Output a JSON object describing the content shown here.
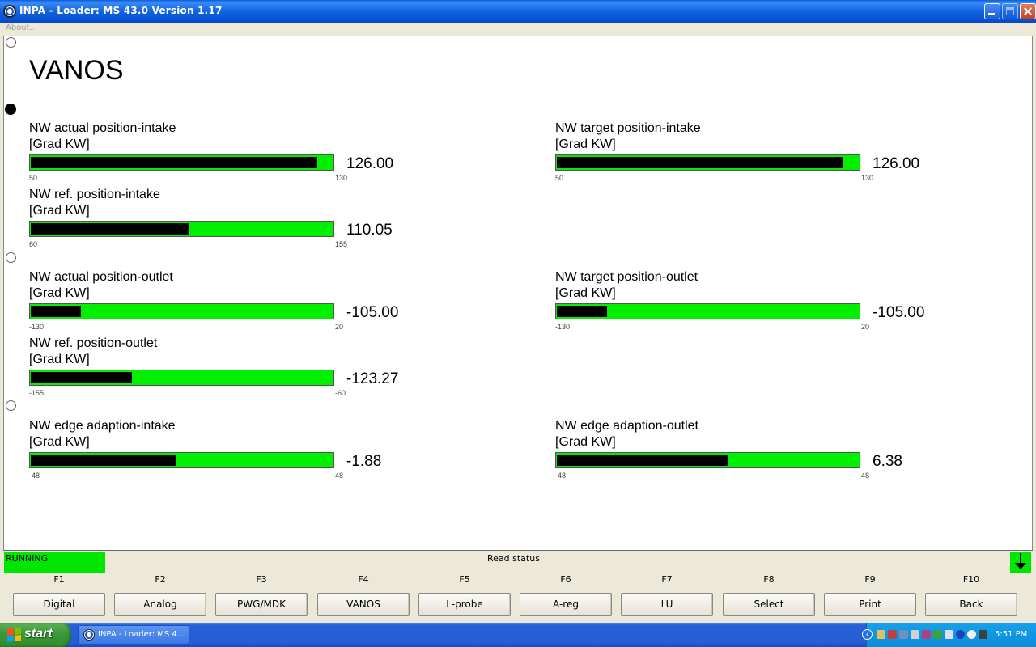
{
  "window": {
    "title": "INPA - Loader:  MS 43.0 Version 1.17"
  },
  "menu": {
    "about": "About..."
  },
  "page": {
    "title": "VANOS"
  },
  "gauges": [
    {
      "label": "NW actual position-intake",
      "unit": "[Grad KW]",
      "value": "126.00",
      "min": "50",
      "max": "130",
      "level": 0.95
    },
    {
      "label": "NW target position-intake",
      "unit": "[Grad KW]",
      "value": "126.00",
      "min": "50",
      "max": "130",
      "level": 0.95
    },
    {
      "label": "NW ref. position-intake",
      "unit": "[Grad KW]",
      "value": "110.05",
      "min": "60",
      "max": "155",
      "level": 0.5268
    },
    {
      "label": "NW actual position-outlet",
      "unit": "[Grad KW]",
      "value": "-105.00",
      "min": "-130",
      "max": "20",
      "level": 0.1667
    },
    {
      "label": "NW target position-outlet",
      "unit": "[Grad KW]",
      "value": "-105.00",
      "min": "-130",
      "max": "20",
      "level": 0.1667
    },
    {
      "label": "NW ref. position-outlet",
      "unit": "[Grad KW]",
      "value": "-123.27",
      "min": "-155",
      "max": "-60",
      "level": 0.334
    },
    {
      "label": "NW edge adaption-intake",
      "unit": "[Grad KW]",
      "value": "-1.88",
      "min": "-48",
      "max": "48",
      "level": 0.4804
    },
    {
      "label": "NW edge adaption-outlet",
      "unit": "[Grad KW]",
      "value": "6.38",
      "min": "-48",
      "max": "48",
      "level": 0.5665
    }
  ],
  "status": {
    "running": "RUNNING",
    "message": "Read status"
  },
  "fkeys": [
    {
      "key": "F1",
      "label": "Digital"
    },
    {
      "key": "F2",
      "label": "Analog"
    },
    {
      "key": "F3",
      "label": "PWG/MDK"
    },
    {
      "key": "F4",
      "label": "VANOS"
    },
    {
      "key": "F5",
      "label": "L-probe"
    },
    {
      "key": "F6",
      "label": "A-reg"
    },
    {
      "key": "F7",
      "label": "LU"
    },
    {
      "key": "F8",
      "label": "Select"
    },
    {
      "key": "F9",
      "label": "Print"
    },
    {
      "key": "F10",
      "label": "Back"
    }
  ],
  "taskbar": {
    "start": "start",
    "task": "INPA - Loader:  MS 4...",
    "clock": "5:51 PM"
  },
  "colors": {
    "gauge_bar": "#00f000",
    "gauge_fill": "#000000",
    "status_running": "#00e600"
  }
}
